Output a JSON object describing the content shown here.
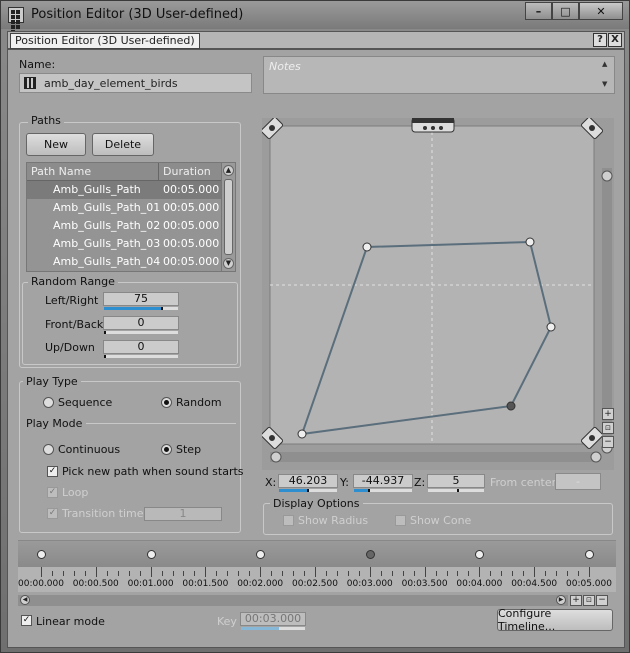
{
  "window": {
    "title": "Position Editor (3D User-defined)",
    "min": "–",
    "max": "□",
    "close": "✕"
  },
  "tab": {
    "label": "Position Editor (3D User-defined)",
    "help": "?",
    "close": "X"
  },
  "name": {
    "label": "Name:",
    "value": "amb_day_element_birds"
  },
  "notes": {
    "placeholder": "Notes"
  },
  "paths": {
    "title": "Paths",
    "new_label": "New",
    "delete_label": "Delete",
    "col_name": "Path Name",
    "col_duration": "Duration",
    "rows": [
      {
        "name": "Amb_Gulls_Path",
        "duration": "00:05.000"
      },
      {
        "name": "Amb_Gulls_Path_01",
        "duration": "00:05.000"
      },
      {
        "name": "Amb_Gulls_Path_02",
        "duration": "00:05.000"
      },
      {
        "name": "Amb_Gulls_Path_03",
        "duration": "00:05.000"
      },
      {
        "name": "Amb_Gulls_Path_04",
        "duration": "00:05.000"
      }
    ]
  },
  "random_range": {
    "title": "Random Range",
    "left_right_label": "Left/Right",
    "left_right_value": "75",
    "left_right_level": 0.75,
    "front_back_label": "Front/Back",
    "front_back_value": "0",
    "up_down_label": "Up/Down",
    "up_down_value": "0"
  },
  "play_type": {
    "title": "Play Type",
    "sequence": "Sequence",
    "random": "Random",
    "selected": "Random"
  },
  "play_mode": {
    "title": "Play Mode",
    "continuous": "Continuous",
    "step": "Step",
    "selected": "Step",
    "pick_new": "Pick new path when sound starts",
    "loop": "Loop",
    "transition": "Transition time",
    "transition_value": "1"
  },
  "coords": {
    "x_label": "X:",
    "x_value": "46.203",
    "y_label": "Y:",
    "y_value": "-44.937",
    "z_label": "Z:",
    "z_value": "5",
    "from_center_label": "From center:",
    "from_center_value": "-"
  },
  "display_options": {
    "title": "Display Options",
    "show_radius": "Show Radius",
    "show_cone": "Show Cone"
  },
  "timeline": {
    "ticks": [
      "00:00.000",
      "00:00.500",
      "00:01.000",
      "00:01.500",
      "00:02.000",
      "00:02.500",
      "00:03.000",
      "00:03.500",
      "00:04.000",
      "00:04.500",
      "00:05.000"
    ],
    "linear_mode": "Linear mode",
    "key_label": "Key",
    "key_value": "00:03.000",
    "configure": "Configure Timeline..."
  },
  "colors": {
    "path_line": "#5a6e7c",
    "accent": "#2d8fd0"
  }
}
